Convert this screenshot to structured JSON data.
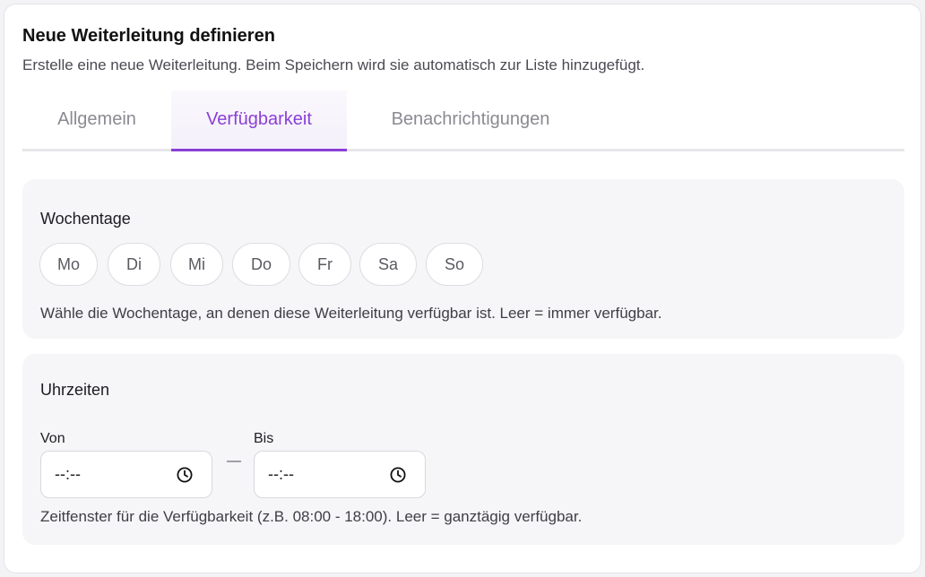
{
  "header": {
    "title": "Neue Weiterleitung definieren",
    "subtitle": "Erstelle eine neue Weiterleitung. Beim Speichern wird sie automatisch zur Liste hinzugefügt."
  },
  "tabs": [
    {
      "label": "Allgemein",
      "active": false
    },
    {
      "label": "Verfügbarkeit",
      "active": true
    },
    {
      "label": "Benachrichtigungen",
      "active": false
    }
  ],
  "weekdays": {
    "title": "Wochentage",
    "days": [
      "Mo",
      "Di",
      "Mi",
      "Do",
      "Fr",
      "Sa",
      "So"
    ],
    "help": "Wähle die Wochentage, an denen diese Weiterleitung verfügbar ist. Leer = immer verfügbar."
  },
  "times": {
    "title": "Uhrzeiten",
    "from": {
      "label": "Von",
      "value": "--:--",
      "icon": "clock-icon"
    },
    "to": {
      "label": "Bis",
      "value": "--:--",
      "icon": "clock-icon"
    },
    "help": "Zeitfenster für die Verfügbarkeit (z.B. 08:00 - 18:00). Leer = ganztägig verfügbar."
  },
  "colors": {
    "accent": "#8b3fd6",
    "section_bg": "#f6f6f8"
  }
}
